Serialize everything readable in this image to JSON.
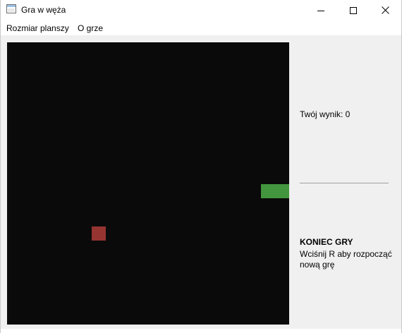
{
  "window": {
    "title": "Gra w węża",
    "icons": {
      "app": "window-app-icon",
      "minimize": "minimize-icon",
      "maximize": "maximize-icon",
      "close": "close-icon"
    }
  },
  "menu": {
    "items": [
      "Rozmiar planszy",
      "O grze"
    ]
  },
  "board": {
    "grid_size": 20,
    "background_color": "#0a0a0a",
    "snake": {
      "color": "#43963d",
      "cells": [
        [
          18,
          10
        ],
        [
          19,
          10
        ]
      ]
    },
    "food": {
      "color": "#963431",
      "cell": [
        6,
        13
      ]
    }
  },
  "side_panel": {
    "score_text": "Twój wynik: 0",
    "game_over_title": "KONIEC GRY",
    "game_over_message": "Wciśnij R aby rozpocząć nową grę"
  }
}
